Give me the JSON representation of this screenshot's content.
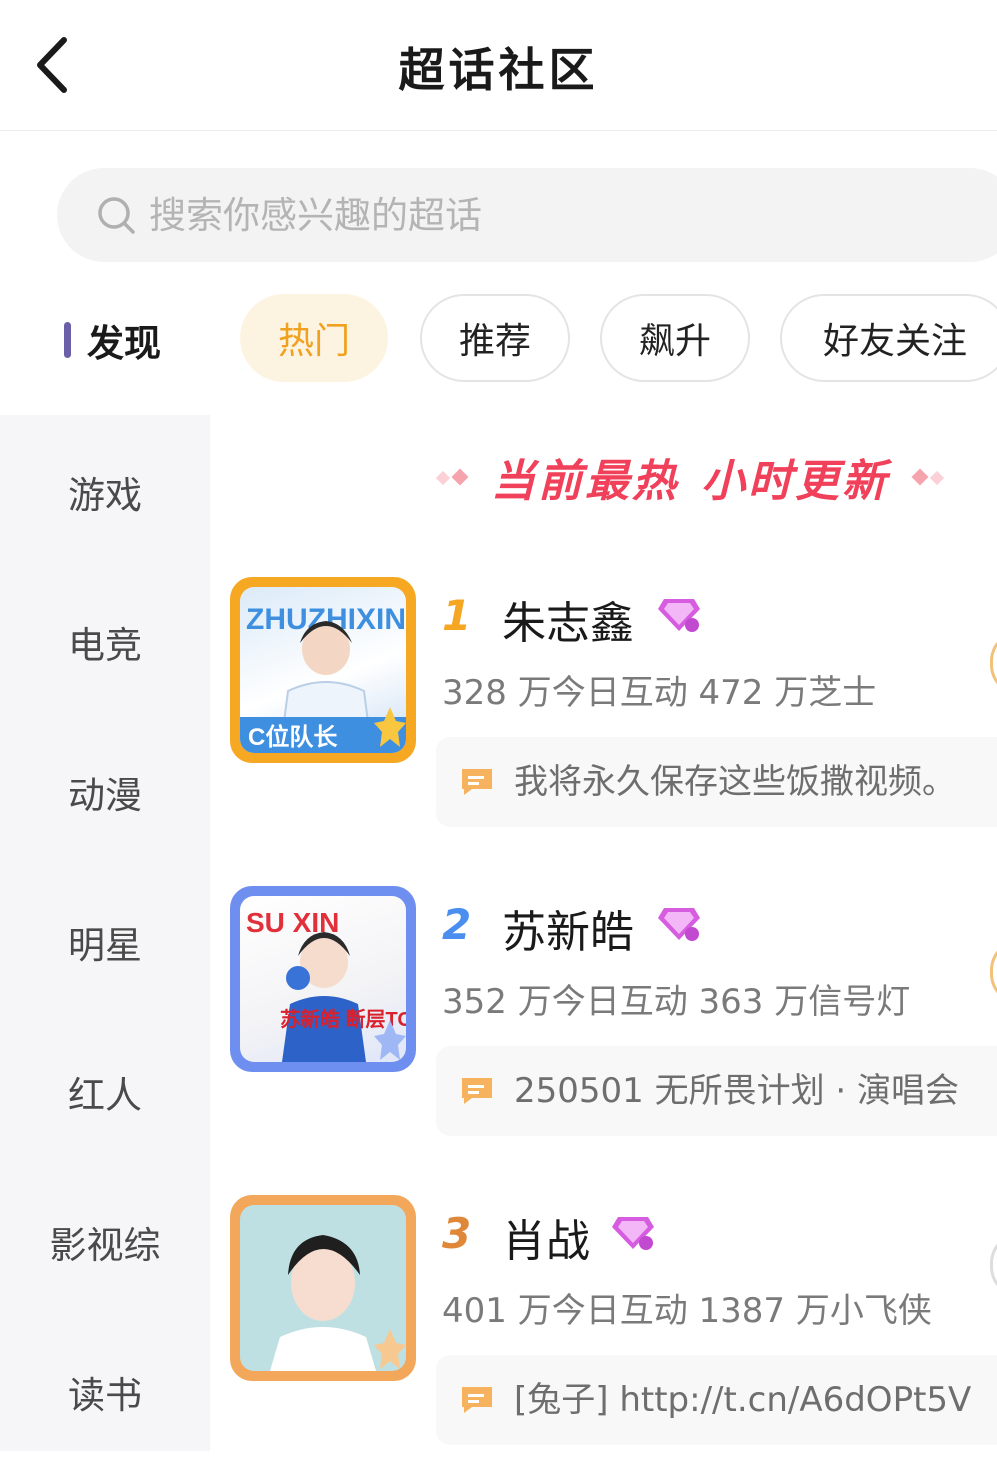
{
  "header": {
    "title": "超话社区"
  },
  "search": {
    "placeholder": "搜索你感兴趣的超话"
  },
  "sidebar": {
    "active": "发现",
    "items": [
      "游戏",
      "电竞",
      "动漫",
      "明星",
      "红人",
      "影视综",
      "读书"
    ]
  },
  "tabs": [
    "热门",
    "推荐",
    "飙升",
    "好友关注"
  ],
  "banner": {
    "left": "当前最热",
    "right": "小时更新"
  },
  "list": [
    {
      "rank": "1",
      "name": "朱志鑫",
      "stats": "328 万今日互动 472 万芝士",
      "post": "我将永久保存这些饭撒视频。",
      "thumb_text_top": "ZHUZHIXIN",
      "thumb_text_bottom": "C位队长"
    },
    {
      "rank": "2",
      "name": "苏新皓",
      "stats": "352 万今日互动 363 万信号灯",
      "post": "250501 无所畏计划 · 演唱会",
      "thumb_text_top": "SU XIN",
      "thumb_text_bottom": "苏新皓 断层TOP"
    },
    {
      "rank": "3",
      "name": "肖战",
      "stats": "401 万今日互动 1387 万小飞侠",
      "post": "[兔子] http://t.cn/A6dOPt5V"
    }
  ],
  "colors": {
    "accent": "#f0a11f",
    "brand_red": "#f0405a",
    "sidebar_bar": "#6b5fa8",
    "rank1": "#f5a623",
    "rank2": "#4a8ef0",
    "rank3": "#e0883a"
  }
}
